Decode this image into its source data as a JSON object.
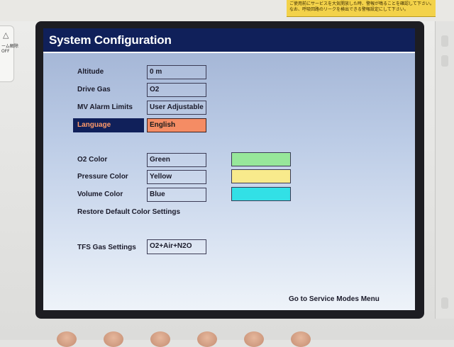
{
  "device": {
    "warning_text": "ご使用前にサービスを大気開放した時、警報が鳴ることを確認して下さい。",
    "warning_text_2": "なお、呼吸回路のリークを検出できる警報設定にして下さい。",
    "left_panel_line1": "ーム解除",
    "left_panel_line2": "OFF"
  },
  "screen": {
    "title": "System Configuration",
    "rows": [
      {
        "label": "Altitude",
        "value": "0 m"
      },
      {
        "label": "Drive Gas",
        "value": "O2"
      },
      {
        "label": "MV Alarm Limits",
        "value": "User Adjustable"
      },
      {
        "label": "Language",
        "value": "English",
        "selected": true
      }
    ],
    "color_rows": [
      {
        "label": "O2 Color",
        "value": "Green",
        "swatch": "#97e79a"
      },
      {
        "label": "Pressure Color",
        "value": "Yellow",
        "swatch": "#f8ea8c"
      },
      {
        "label": "Volume Color",
        "value": "Blue",
        "swatch": "#32e0e6"
      }
    ],
    "restore_label": "Restore Default Color Settings",
    "tfs": {
      "label": "TFS Gas Settings",
      "value": "O2+Air+N2O"
    },
    "service_link": "Go to Service Modes Menu"
  },
  "colors": {
    "title_bar": "#10205a",
    "selection_bg": "#10205a",
    "selection_text": "#ff9a6a",
    "selected_value_bg": "#f58c64"
  }
}
